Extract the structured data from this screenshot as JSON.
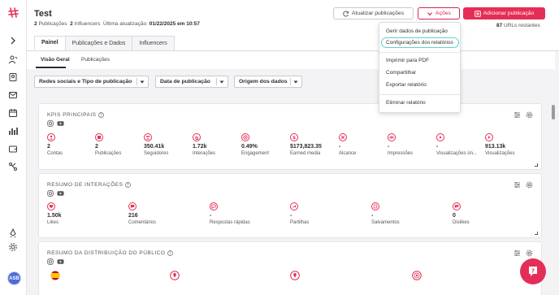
{
  "header": {
    "title": "Test",
    "pub_count": "2",
    "pub_label": "Publicações",
    "inf_count": "2",
    "inf_label": "Influencers",
    "last_update": "Última atualização:",
    "last_update_value": "01/22/2025 em 10:57",
    "refresh_label": "Atualizar publicações",
    "actions_label": "Ações",
    "add_label": "Adicionar publicação",
    "urls_count": "87",
    "urls_label": "URLs restantes",
    "tabs": [
      {
        "label": "Painel",
        "active": true
      },
      {
        "label": "Publicações e Dados",
        "active": false
      },
      {
        "label": "Influencers",
        "active": false
      }
    ]
  },
  "subtabs": [
    {
      "label": "Visão Geral",
      "active": true
    },
    {
      "label": "Publicações",
      "active": false
    }
  ],
  "filters": [
    {
      "label": "Redes sociais e Tipo de publicação"
    },
    {
      "label": "Data de publicação"
    },
    {
      "label": "Origem dos dados"
    }
  ],
  "dropdown": {
    "items": [
      {
        "label": "Gerir dados de publicação"
      },
      {
        "label": "Configurações dos relatórios",
        "highlighted": true
      },
      {
        "label": "Imprimir para PDF"
      },
      {
        "label": "Compartilhar"
      },
      {
        "label": "Exportar relatório"
      },
      {
        "label": "Eliminar relatório"
      }
    ]
  },
  "panels": [
    {
      "title": "KPIS PRINCIPAIS",
      "metrics": [
        {
          "icon": "user-icon",
          "value": "2",
          "label": "Contas"
        },
        {
          "icon": "square-icon",
          "value": "2",
          "label": "Publicações"
        },
        {
          "icon": "users-icon",
          "value": "350.41k",
          "label": "Seguidores"
        },
        {
          "icon": "hand-icon",
          "value": "1.72k",
          "label": "Interações"
        },
        {
          "icon": "target-icon",
          "value": "0.49%",
          "label": "Engagement"
        },
        {
          "icon": "dollar-icon",
          "value": "$173,823.35",
          "label": "Earned media"
        },
        {
          "icon": "arrows-icon",
          "value": "-",
          "label": "Alcance"
        },
        {
          "icon": "eye-icon",
          "value": "-",
          "label": "Impressões"
        },
        {
          "icon": "play-icon",
          "value": "-",
          "label": "Visualizações ún..."
        },
        {
          "icon": "play-icon",
          "value": "913.13k",
          "label": "Visualizações"
        }
      ]
    },
    {
      "title": "RESUMO DE INTERAÇÕES",
      "metrics": [
        {
          "icon": "heart-icon",
          "value": "1.50k",
          "label": "Likes"
        },
        {
          "icon": "comment-icon",
          "value": "216",
          "label": "Comentários"
        },
        {
          "icon": "heart-chat-icon",
          "value": "-",
          "label": "Respostas rápidas"
        },
        {
          "icon": "share-icon",
          "value": "-",
          "label": "Partilhas"
        },
        {
          "icon": "bookmark-icon",
          "value": "-",
          "label": "Salvamentos"
        },
        {
          "icon": "dislike-icon",
          "value": "0",
          "label": "Dislikes"
        }
      ]
    },
    {
      "title": "RESUMO DA DISTRIBUIÇÃO DO PÚBLICO"
    }
  ],
  "avatar": "ASB",
  "colors": {
    "accent": "#e52e57",
    "highlight": "#5fd3cf",
    "text": "#2b2b35"
  }
}
